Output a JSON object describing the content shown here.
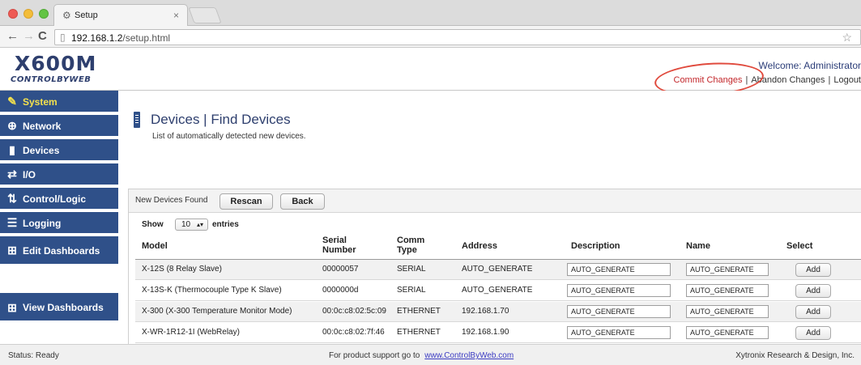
{
  "browser": {
    "tab_title": "Setup",
    "tab_close": "×",
    "url_host": "192.168.1.2",
    "url_path": "/setup.html"
  },
  "header": {
    "logo_main": "X600M",
    "logo_sub": "CONTROLBYWEB",
    "welcome": "Welcome: Administrator",
    "commit": "Commit Changes",
    "abandon": "Abandon Changes",
    "logout": "Logout",
    "sep": "|"
  },
  "sidebar": {
    "items": [
      {
        "label": "System",
        "icon": "wrench-icon",
        "glyph": "🔧"
      },
      {
        "label": "Network",
        "icon": "globe-icon",
        "glyph": "⊕"
      },
      {
        "label": "Devices",
        "icon": "device-icon",
        "glyph": "▮"
      },
      {
        "label": "I/O",
        "icon": "io-arrows-icon",
        "glyph": "⇄"
      },
      {
        "label": "Control/Logic",
        "icon": "control-logic-icon",
        "glyph": "⇅"
      },
      {
        "label": "Logging",
        "icon": "logging-icon",
        "glyph": "☰"
      },
      {
        "label": "Edit Dashboards",
        "icon": "dashboard-icon",
        "glyph": "⊞"
      }
    ],
    "view_dashboards": {
      "label": "View Dashboards",
      "icon": "dashboard-icon",
      "glyph": "⊞"
    }
  },
  "main": {
    "title": "Devices | Find Devices",
    "subtitle": "List of automatically detected new devices.",
    "panel_label": "New Devices Found",
    "rescan": "Rescan",
    "back": "Back",
    "show": "Show",
    "show_value": "10",
    "entries": "entries",
    "columns": {
      "model": "Model",
      "serial": "Serial Number",
      "comm": "Comm Type",
      "address": "Address",
      "description": "Description",
      "name": "Name",
      "select": "Select"
    },
    "rows": [
      {
        "model": "X-12S (8 Relay Slave)",
        "serial": "00000057",
        "comm": "SERIAL",
        "address": "AUTO_GENERATE",
        "description": "AUTO_GENERATE",
        "name": "AUTO_GENERATE",
        "select": "Add"
      },
      {
        "model": "X-13S-K (Thermocouple Type K Slave)",
        "serial": "0000000d",
        "comm": "SERIAL",
        "address": "AUTO_GENERATE",
        "description": "AUTO_GENERATE",
        "name": "AUTO_GENERATE",
        "select": "Add"
      },
      {
        "model": "X-300 (X-300 Temperature Monitor Mode)",
        "serial": "00:0c:c8:02:5c:09",
        "comm": "ETHERNET",
        "address": "192.168.1.70",
        "description": "AUTO_GENERATE",
        "name": "AUTO_GENERATE",
        "select": "Add"
      },
      {
        "model": "X-WR-1R12-1I (WebRelay)",
        "serial": "00:0c:c8:02:7f:46",
        "comm": "ETHERNET",
        "address": "192.168.1.90",
        "description": "AUTO_GENERATE",
        "name": "AUTO_GENERATE",
        "select": "Add"
      }
    ]
  },
  "status": {
    "left": "Status:  Ready",
    "center": "For product support go to",
    "link": "www.ControlByWeb.com",
    "right": "Xytronix Research & Design, Inc."
  },
  "colors": {
    "sidebar_bg": "#2f5089",
    "active_label": "#f5e24c",
    "commit_link": "#c3272b",
    "annotation_circle": "#e04a3d"
  }
}
